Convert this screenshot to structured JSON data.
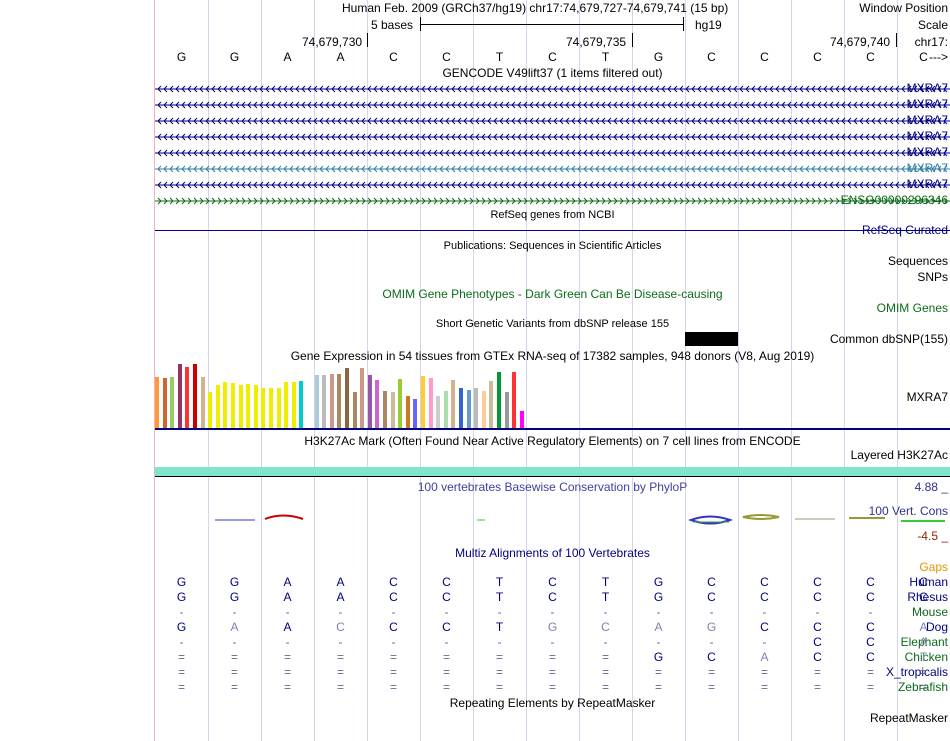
{
  "header": {
    "window_position_label": "Window Position",
    "scale_label": "Scale",
    "chrom_label": "chr17:",
    "strand_label": "--->",
    "assembly_text": "Human Feb. 2009 (GRCh37/hg19)   chr17:74,679,727-74,679,741 (15 bp)",
    "scale_text": "5 bases",
    "db_text": "hg19",
    "ticks": [
      "74,679,730",
      "74,679,735",
      "74,679,740"
    ]
  },
  "sequence": [
    "G",
    "G",
    "A",
    "A",
    "C",
    "C",
    "T",
    "C",
    "T",
    "G",
    "C",
    "C",
    "C",
    "C",
    "C"
  ],
  "gencode": {
    "title": "GENCODE V49lift37 (1 items filtered out)",
    "rows": [
      {
        "label": "MXRA7",
        "color": "#000080",
        "dir": "minus"
      },
      {
        "label": "MXRA7",
        "color": "#000080",
        "dir": "minus"
      },
      {
        "label": "MXRA7",
        "color": "#000080",
        "dir": "minus"
      },
      {
        "label": "MXRA7",
        "color": "#000080",
        "dir": "minus"
      },
      {
        "label": "MXRA7",
        "color": "#000080",
        "dir": "minus"
      },
      {
        "label": "MXRA7",
        "color": "#2f7f9f",
        "dir": "minus"
      },
      {
        "label": "MXRA7",
        "color": "#000080",
        "dir": "minus"
      },
      {
        "label": "ENSG00000296346",
        "color": "#0d6b1a",
        "dir": "plus"
      }
    ]
  },
  "refseq": {
    "title": "RefSeq genes from NCBI",
    "label": "RefSeq Curated"
  },
  "publications": {
    "title": "Publications: Sequences in Scientific Articles",
    "label1": "Sequences",
    "label2": "SNPs"
  },
  "omim": {
    "label": "OMIM Genes",
    "title": "OMIM Gene Phenotypes - Dark Green Can Be Disease-causing"
  },
  "dbsnp": {
    "title": "Short Genetic Variants from dbSNP release 155",
    "label": "Common dbSNP(155)"
  },
  "gtex": {
    "title": "Gene Expression in 54 tissues from GTEx RNA-seq of 17382 samples, 948 donors (V8, Aug 2019)",
    "label": "MXRA7",
    "bars": [
      {
        "c": "#ff9933",
        "h": 0.8
      },
      {
        "c": "#cc6633",
        "h": 0.78
      },
      {
        "c": "#99cc66",
        "h": 0.8
      },
      {
        "c": "#993366",
        "h": 1.0
      },
      {
        "c": "#ff3333",
        "h": 0.96
      },
      {
        "c": "#cc0000",
        "h": 1.0
      },
      {
        "c": "#d2b48c",
        "h": 0.8
      },
      {
        "c": "#eeee00",
        "h": 0.56
      },
      {
        "c": "#eeee00",
        "h": 0.67
      },
      {
        "c": "#eeee00",
        "h": 0.72
      },
      {
        "c": "#eeee00",
        "h": 0.7
      },
      {
        "c": "#eeee00",
        "h": 0.67
      },
      {
        "c": "#eeee00",
        "h": 0.68
      },
      {
        "c": "#eeee00",
        "h": 0.67
      },
      {
        "c": "#eeee00",
        "h": 0.62
      },
      {
        "c": "#eeee00",
        "h": 0.62
      },
      {
        "c": "#eeee00",
        "h": 0.62
      },
      {
        "c": "#eeee00",
        "h": 0.72
      },
      {
        "c": "#eeee00",
        "h": 0.72
      },
      {
        "c": "#00cccc",
        "h": 0.73
      },
      {
        "c": "#ffffff",
        "h": 0.0
      },
      {
        "c": "#aaccdd",
        "h": 0.83
      },
      {
        "c": "#bbbbbb",
        "h": 0.83
      },
      {
        "c": "#cc9988",
        "h": 0.85
      },
      {
        "c": "#aa8866",
        "h": 0.84
      },
      {
        "c": "#886644",
        "h": 0.93
      },
      {
        "c": "#aa8866",
        "h": 0.57
      },
      {
        "c": "#cc9988",
        "h": 0.93
      },
      {
        "c": "#9955aa",
        "h": 0.83
      },
      {
        "c": "#cc66cc",
        "h": 0.75
      },
      {
        "c": "#aa8866",
        "h": 0.58
      },
      {
        "c": "#ccbb99",
        "h": 0.57
      },
      {
        "c": "#99cc33",
        "h": 0.76
      },
      {
        "c": "#cc7722",
        "h": 0.5
      },
      {
        "c": "#6666ff",
        "h": 0.45
      },
      {
        "c": "#ffcc33",
        "h": 0.82
      },
      {
        "c": "#ff99cc",
        "h": 0.78
      },
      {
        "c": "#cccccc",
        "h": 0.5
      },
      {
        "c": "#aaddaa",
        "h": 0.58
      },
      {
        "c": "#d2b48c",
        "h": 0.75
      },
      {
        "c": "#3366cc",
        "h": 0.62
      },
      {
        "c": "#6699cc",
        "h": 0.6
      },
      {
        "c": "#bbbbbb",
        "h": 0.62
      },
      {
        "c": "#ffcc99",
        "h": 0.58
      },
      {
        "c": "#ccbb99",
        "h": 0.73
      },
      {
        "c": "#009933",
        "h": 0.88
      },
      {
        "c": "#999999",
        "h": 0.56
      },
      {
        "c": "#ff3333",
        "h": 0.88
      },
      {
        "c": "#ff00ff",
        "h": 0.27
      }
    ]
  },
  "h3k27ac": {
    "title": "H3K27Ac Mark (Often Found Near Active Regulatory Elements) on 7 cell lines from ENCODE",
    "label": "Layered H3K27Ac",
    "color": "#7fe5cc"
  },
  "phylop": {
    "title": "100 vertebrates Basewise Conservation by PhyloP",
    "label": "100 Vert. Cons",
    "max_label": "4.88 _",
    "min_label": "-4.5 _"
  },
  "multiz": {
    "title": "Multiz Alignments of 100 Vertebrates",
    "gaps_label": "Gaps",
    "species": [
      {
        "name": "Human",
        "color": "#000080",
        "bases": [
          "G",
          "G",
          "A",
          "A",
          "C",
          "C",
          "T",
          "C",
          "T",
          "G",
          "C",
          "C",
          "C",
          "C",
          "C"
        ]
      },
      {
        "name": "Rhesus",
        "color": "#000080",
        "bases": [
          "G",
          "G",
          "A",
          "A",
          "C",
          "C",
          "T",
          "C",
          "T",
          "G",
          "C",
          "C",
          "C",
          "C",
          "C"
        ]
      },
      {
        "name": "Mouse",
        "color": "#0d6b1a",
        "bases": [
          "-",
          "-",
          "-",
          "-",
          "-",
          "-",
          "-",
          "-",
          "-",
          "-",
          "-",
          "-",
          "-",
          "-",
          "-"
        ]
      },
      {
        "name": "Dog",
        "color": "#000080",
        "bases": [
          "G",
          "A",
          "A",
          "C",
          "C",
          "C",
          "T",
          "G",
          "C",
          "A",
          "G",
          "C",
          "C",
          "C",
          "A"
        ]
      },
      {
        "name": "Elephant",
        "color": "#0d6b1a",
        "bases": [
          "-",
          "-",
          "-",
          "-",
          "-",
          "-",
          "-",
          "-",
          "-",
          "-",
          "-",
          "-",
          "C",
          "C",
          "A"
        ]
      },
      {
        "name": "Chicken",
        "color": "#0d6b1a",
        "bases": [
          "=",
          "=",
          "=",
          "=",
          "=",
          "=",
          "=",
          "=",
          "=",
          "G",
          "C",
          "A",
          "C",
          "C",
          "T"
        ]
      },
      {
        "name": "X_tropicalis",
        "color": "#000080",
        "bases": [
          "=",
          "=",
          "=",
          "=",
          "=",
          "=",
          "=",
          "=",
          "=",
          "=",
          "=",
          "=",
          "=",
          "=",
          "="
        ]
      },
      {
        "name": "Zebrafish",
        "color": "#0d6b1a",
        "bases": [
          "=",
          "=",
          "=",
          "=",
          "=",
          "=",
          "=",
          "=",
          "=",
          "=",
          "=",
          "=",
          "=",
          "=",
          "="
        ]
      }
    ]
  },
  "repeatmasker": {
    "title": "Repeating Elements by RepeatMasker",
    "label": "RepeatMasker"
  }
}
